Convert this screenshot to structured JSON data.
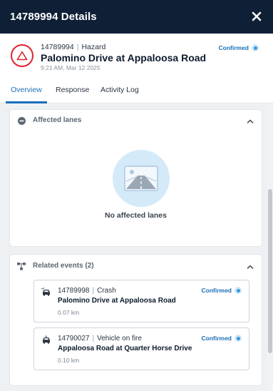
{
  "header": {
    "title": "14789994 Details"
  },
  "incident": {
    "id": "14789994",
    "type": "Hazard",
    "road": "Palomino Drive at Appaloosa Road",
    "time": "9:21 AM, Mar 12 2025",
    "status": "Confirmed"
  },
  "tabs": [
    {
      "label": "Overview"
    },
    {
      "label": "Response"
    },
    {
      "label": "Activity Log"
    }
  ],
  "affected_lanes": {
    "title": "Affected lanes",
    "empty_text": "No affected lanes"
  },
  "related_events": {
    "title": "Related events (2)",
    "items": [
      {
        "id": "14789998",
        "type": "Crash",
        "road": "Palomino Drive at Appaloosa Road",
        "distance": "0.07 km",
        "status": "Confirmed"
      },
      {
        "id": "14790027",
        "type": "Vehicle on fire",
        "road": "Appaloosa Road at Quarter Horse Drive",
        "distance": "0.10 km",
        "status": "Confirmed"
      }
    ]
  },
  "colors": {
    "header_bg": "#0f1f36",
    "accent": "#1a6fba",
    "hazard": "#e0232b",
    "confirmed_dot": "#2f9ae0"
  },
  "icons": {
    "close": "close-icon",
    "hazard": "hazard-triangle-icon",
    "lanes": "minus-circle-icon",
    "related": "event-tree-icon",
    "event": "car-crash-icon",
    "collapse": "chevron-up-icon"
  }
}
